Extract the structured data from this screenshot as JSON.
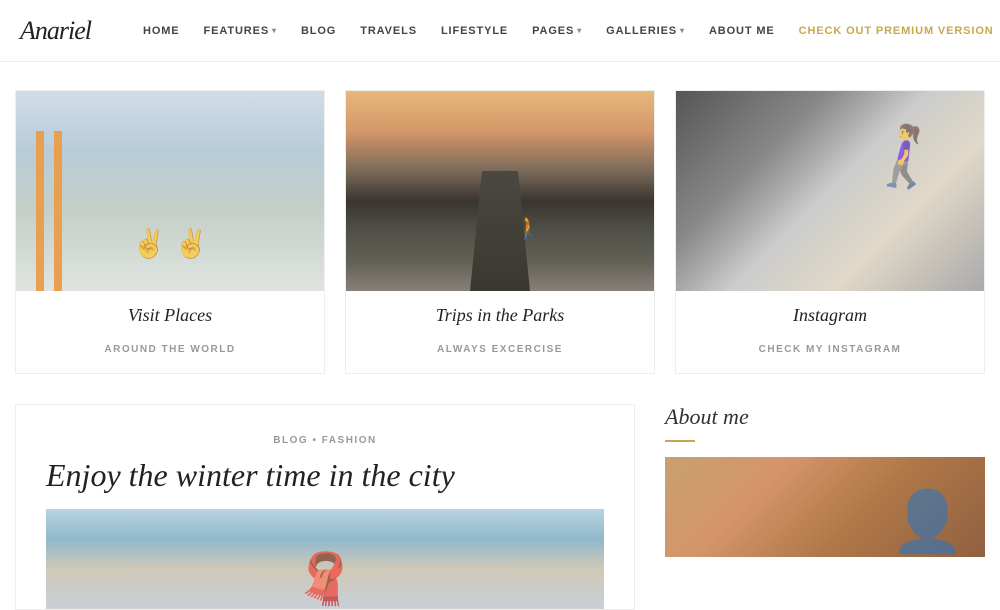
{
  "logo": {
    "text": "Anariel"
  },
  "nav": {
    "items": [
      {
        "label": "HOME",
        "hasDropdown": false
      },
      {
        "label": "FEATURES",
        "hasDropdown": true
      },
      {
        "label": "BLOG",
        "hasDropdown": false
      },
      {
        "label": "TRAVELS",
        "hasDropdown": false
      },
      {
        "label": "LIFESTYLE",
        "hasDropdown": false
      },
      {
        "label": "PAGES",
        "hasDropdown": true
      },
      {
        "label": "GALLERIES",
        "hasDropdown": true
      },
      {
        "label": "ABOUT ME",
        "hasDropdown": false
      }
    ],
    "premium": "CHECK OUT PREMIUM VERSION"
  },
  "cards": [
    {
      "title": "Visit Places",
      "subtitle": "AROUND THE WORLD",
      "imageType": "bridge"
    },
    {
      "title": "Trips in the Parks",
      "subtitle": "ALWAYS EXCERCISE",
      "imageType": "road"
    },
    {
      "title": "Instagram",
      "subtitle": "CHECK MY INSTAGRAM",
      "imageType": "instagram"
    }
  ],
  "blog": {
    "category": "BLOG • FASHION",
    "title": "Enjoy the winter time in the city"
  },
  "about": {
    "title": "About me",
    "divider_color": "#c9a84c"
  }
}
